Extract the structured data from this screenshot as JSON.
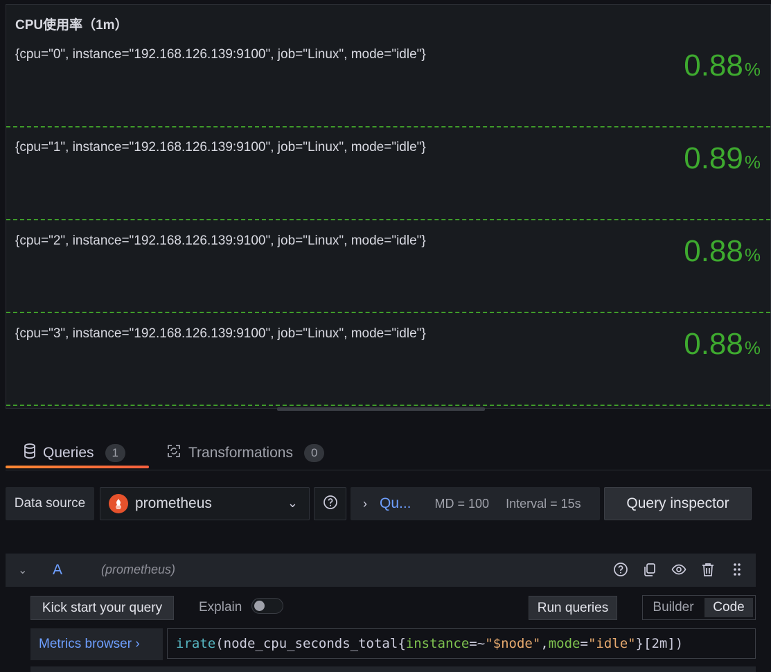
{
  "panel": {
    "title": "CPU使用率（1m）",
    "rows": [
      {
        "label": "{cpu=\"0\", instance=\"192.168.126.139:9100\", job=\"Linux\", mode=\"idle\"}",
        "value": "0.88",
        "unit": "%"
      },
      {
        "label": "{cpu=\"1\", instance=\"192.168.126.139:9100\", job=\"Linux\", mode=\"idle\"}",
        "value": "0.89",
        "unit": "%"
      },
      {
        "label": "{cpu=\"2\", instance=\"192.168.126.139:9100\", job=\"Linux\", mode=\"idle\"}",
        "value": "0.88",
        "unit": "%"
      },
      {
        "label": "{cpu=\"3\", instance=\"192.168.126.139:9100\", job=\"Linux\", mode=\"idle\"}",
        "value": "0.88",
        "unit": "%"
      }
    ],
    "value_color": "#3eaa2f"
  },
  "tabs": [
    {
      "label": "Queries",
      "count": "1",
      "icon": "database-icon",
      "active": true
    },
    {
      "label": "Transformations",
      "count": "0",
      "icon": "transform-icon",
      "active": false
    }
  ],
  "datasource": {
    "label": "Data source",
    "selected": "prometheus",
    "options_summary": {
      "short": "Qu...",
      "md": "MD = 100",
      "interval": "Interval = 15s"
    },
    "inspector_label": "Query inspector"
  },
  "query": {
    "ref": "A",
    "datasource": "(prometheus)",
    "kick_start_label": "Kick start your query",
    "explain_label": "Explain",
    "run_label": "Run queries",
    "mode_builder": "Builder",
    "mode_code": "Code",
    "metrics_browser_label": "Metrics browser ›",
    "expr_parts": {
      "fn": "irate",
      "open": "(",
      "metric": "node_cpu_seconds_total",
      "brace_open": "{",
      "l1": "instance",
      "op1": "=~",
      "v1": "\"$node\"",
      "comma": ",",
      "l2": "mode",
      "op2": "=",
      "v2": "\"idle\"",
      "brace_close": "}",
      "range": "[2m]",
      "close": ")"
    }
  },
  "colors": {
    "accent": "#ff8833",
    "link": "#6e9fff",
    "background": "#111217"
  }
}
